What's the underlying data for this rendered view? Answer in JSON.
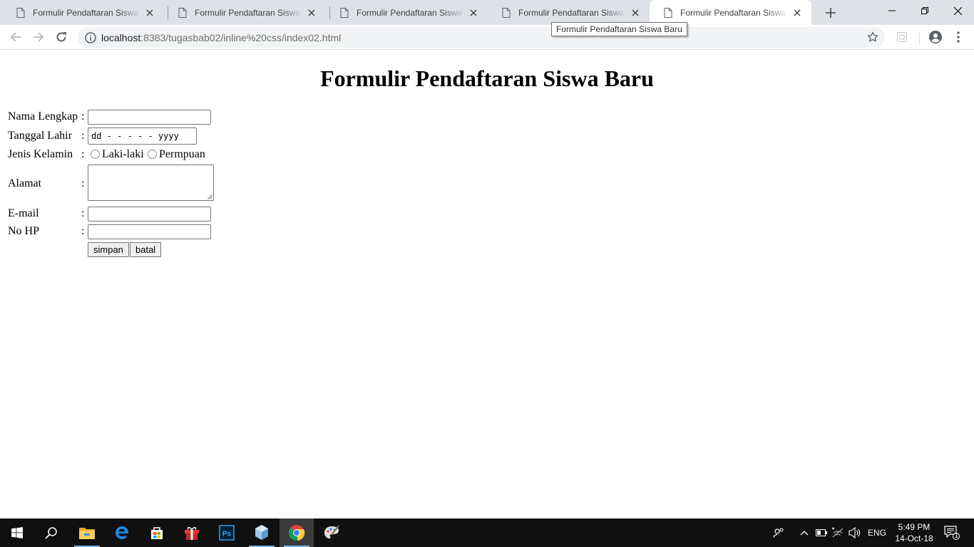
{
  "browser": {
    "tabs": [
      {
        "title": "Formulir Pendaftaran Siswa Baru",
        "active": false
      },
      {
        "title": "Formulir Pendaftaran Siswa Baru",
        "active": false
      },
      {
        "title": "Formulir Pendaftaran Siswa Baru",
        "active": false
      },
      {
        "title": "Formulir Pendaftaran Siswa Baru",
        "active": false
      },
      {
        "title": "Formulir Pendaftaran Siswa Baru",
        "active": true
      }
    ],
    "tooltip": "Formulir Pendaftaran Siswa Baru",
    "url_host": "localhost",
    "url_rest": ":8383/tugasbab02/inline%20css/index02.html"
  },
  "form": {
    "title": "Formulir Pendaftaran Siswa Baru",
    "fields": {
      "nama": {
        "label": "Nama Lengkap",
        "colon": ":",
        "value": ""
      },
      "tanggal": {
        "label": "Tanggal Lahir",
        "colon": ":",
        "placeholder": "dd - - - - - yyyy"
      },
      "kelamin": {
        "label": "Jenis Kelamin",
        "colon": ":",
        "options": [
          "Laki-laki",
          "Permpuan"
        ]
      },
      "alamat": {
        "label": "Alamat",
        "colon": ":",
        "value": ""
      },
      "email": {
        "label": "E-mail",
        "colon": ":",
        "value": ""
      },
      "hp": {
        "label": "No HP",
        "colon": ":",
        "value": ""
      }
    },
    "buttons": {
      "save": "simpan",
      "cancel": "batal"
    }
  },
  "taskbar": {
    "apps": [
      "start",
      "search",
      "file-explorer",
      "edge",
      "store",
      "gift",
      "photoshop",
      "cube-app",
      "chrome",
      "paint-app"
    ],
    "tray_lang": "ENG",
    "time": "5:49 PM",
    "date": "14-Oct-18",
    "notification_count": "1"
  },
  "colors": {
    "tabstrip": "#dee1e6",
    "taskbar": "#101010",
    "accent_running": "#76b9ed"
  }
}
